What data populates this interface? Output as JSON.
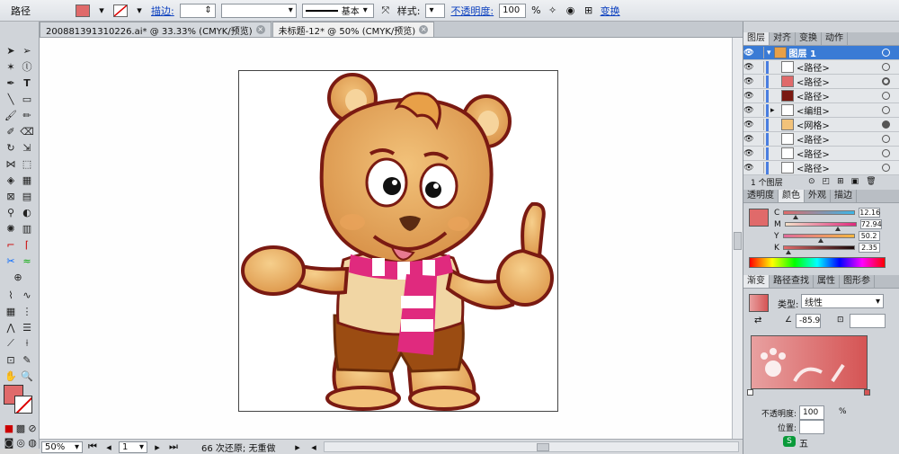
{
  "control_bar": {
    "object_type": "路径",
    "stroke_label": "描边:",
    "stroke_profile": "基本",
    "style_label": "样式:",
    "opacity_label": "不透明度:",
    "opacity_value": "100",
    "opacity_unit": "%",
    "transform_label": "变换"
  },
  "tabs": [
    {
      "label": "200881391310226.ai* @ 33.33% (CMYK/预览)"
    },
    {
      "label": "未标题-12* @ 50% (CMYK/预览)"
    }
  ],
  "status_bar": {
    "zoom": "50%",
    "page": "1",
    "status_text": "66 次还原; 无重做"
  },
  "layers_panel": {
    "tabs": [
      "图层",
      "对齐",
      "变换",
      "动作"
    ],
    "layer_name": "图层 1",
    "items": [
      "<路径>",
      "<路径>",
      "<路径>",
      "<编组>",
      "<网格>",
      "<路径>",
      "<路径>",
      "<路径>"
    ],
    "count_text": "1 个图层"
  },
  "color_panel": {
    "tabs": [
      "透明度",
      "颜色",
      "外观",
      "描边"
    ],
    "channels": [
      {
        "name": "C",
        "value": "12.16",
        "level": 0.1216
      },
      {
        "name": "M",
        "value": "72.94",
        "level": 0.7294
      },
      {
        "name": "Y",
        "value": "50.2",
        "level": 0.502
      },
      {
        "name": "K",
        "value": "2.35",
        "level": 0.0235
      }
    ]
  },
  "gradient_panel": {
    "tabs": [
      "渐变",
      "路径查找",
      "属性",
      "图形参"
    ],
    "type_label": "类型:",
    "type_value": "线性",
    "angle_value": "-85.9",
    "opacity_label": "不透明度:",
    "opacity_value": "100",
    "opacity_unit": "%",
    "location_label": "位置:",
    "ime_label": "五"
  },
  "colors": {
    "fill": "#e06a6a",
    "accent": "#3a7bd5",
    "gradient_start": "#e8a0a0",
    "gradient_end": "#d55454"
  }
}
